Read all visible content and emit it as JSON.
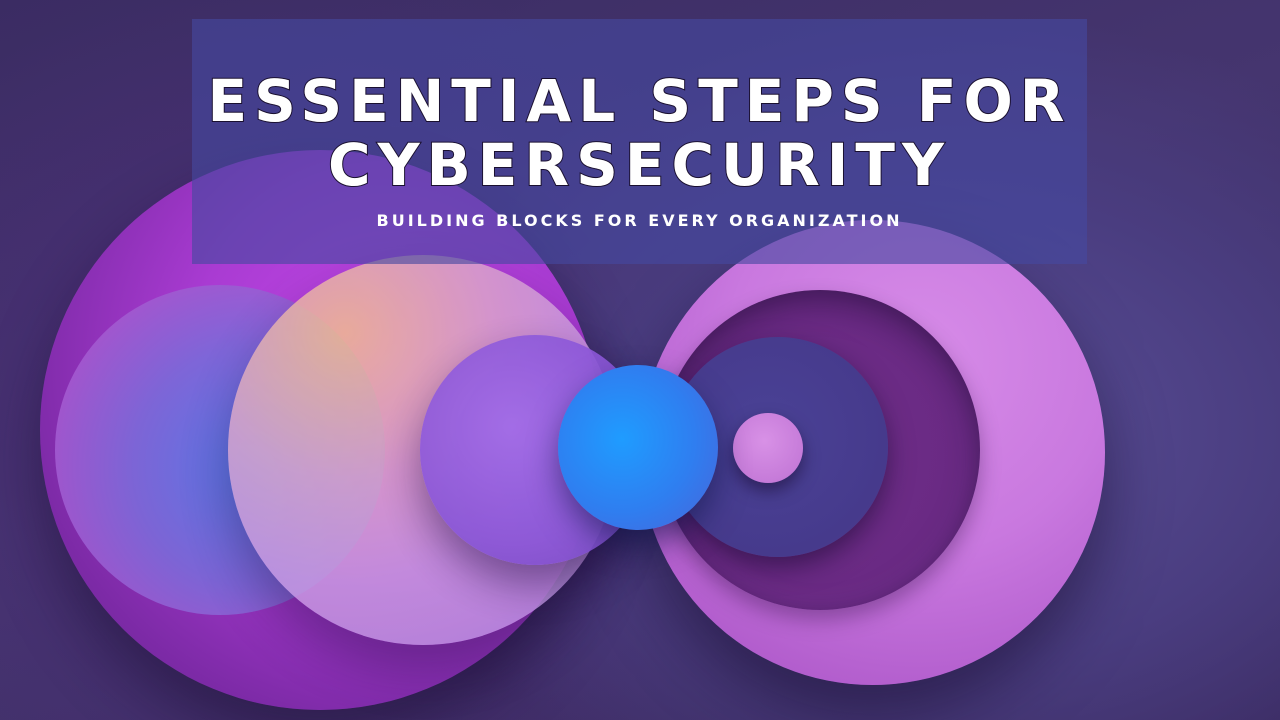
{
  "slide": {
    "title_line1": "ESSENTIAL STEPS FOR",
    "title_line2": "CYBERSECURITY",
    "subtitle": "BUILDING BLOCKS FOR EVERY ORGANIZATION"
  },
  "colors": {
    "background": "#3a2a5e",
    "panel": "#4648a0",
    "title_text": "#ffffff",
    "accent_magenta": "#c349e8",
    "accent_blue": "#1f9cff",
    "accent_pink": "#d78ce8"
  }
}
